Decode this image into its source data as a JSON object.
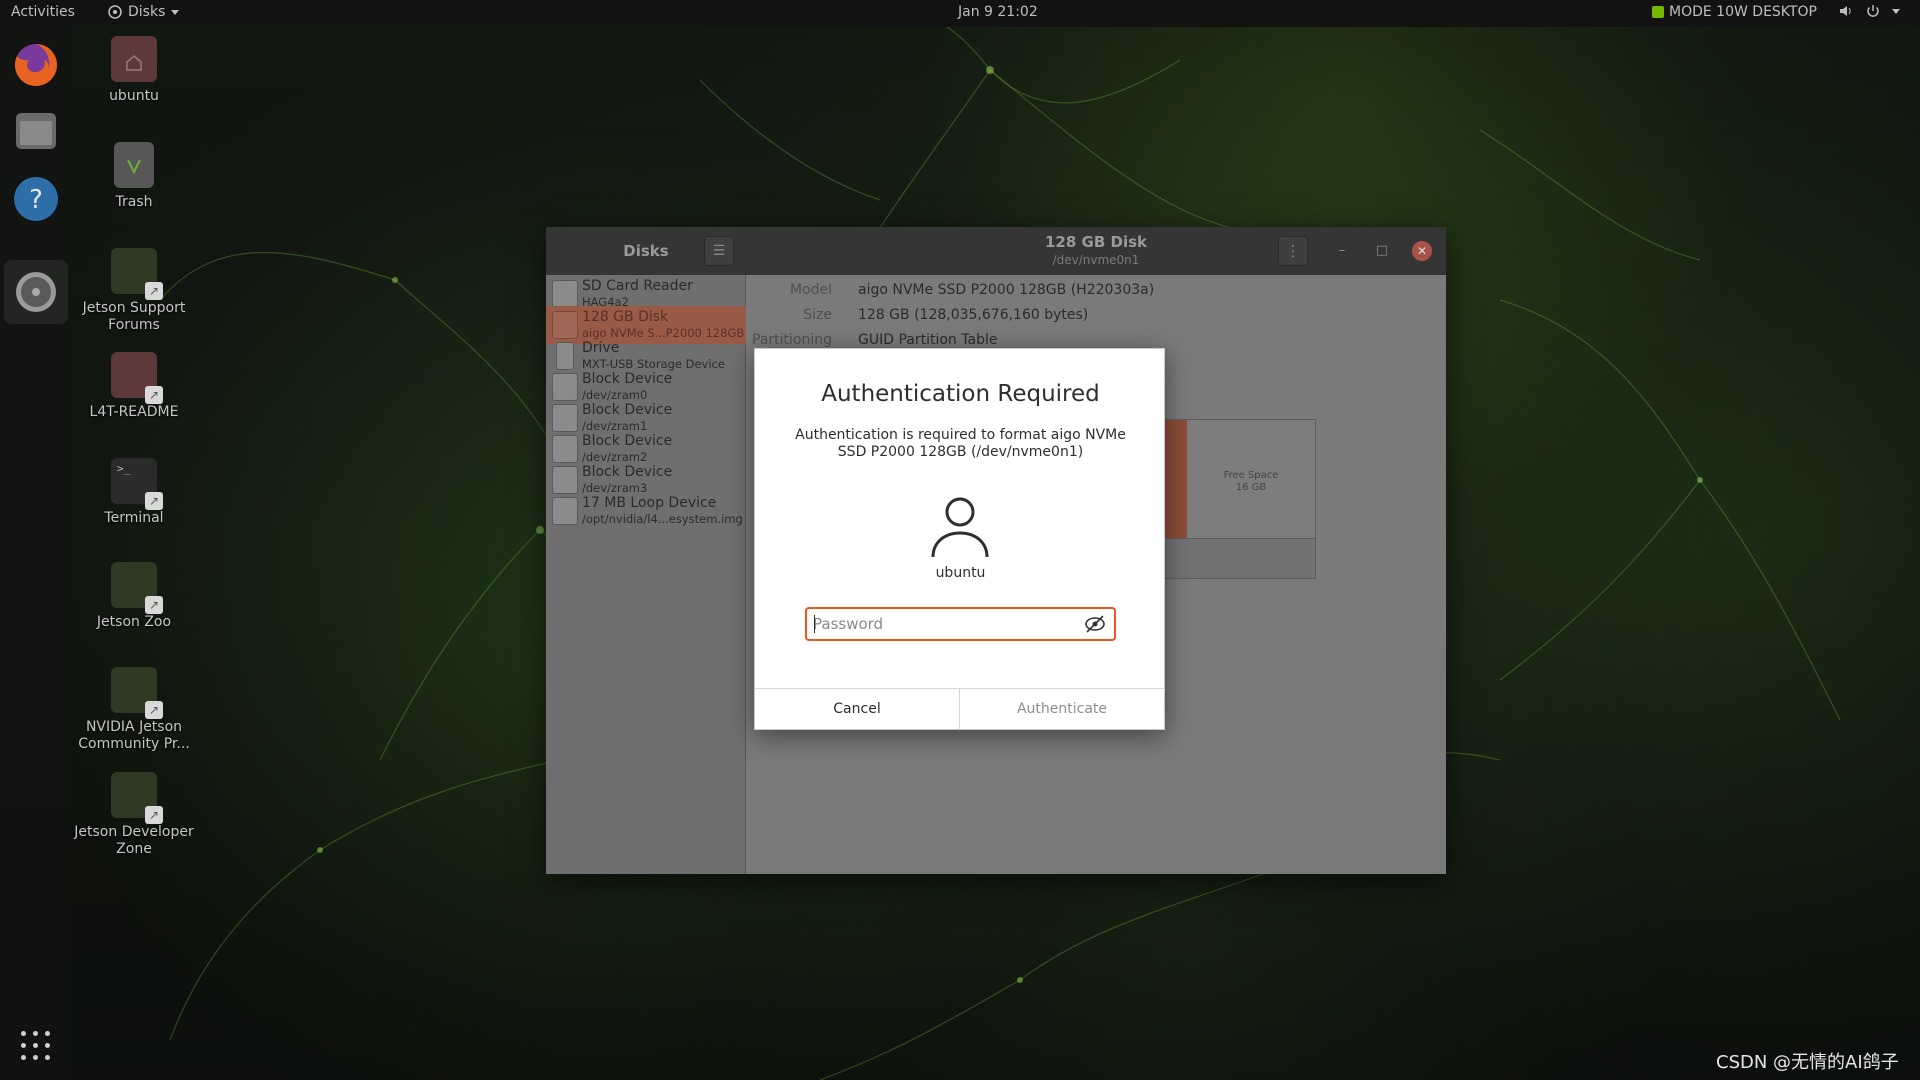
{
  "topbar": {
    "activities": "Activities",
    "app_name": "Disks",
    "clock": "Jan 9  21:02",
    "power_mode": "MODE 10W DESKTOP"
  },
  "dock": {
    "items": [
      {
        "name": "Firefox",
        "icon": "firefox-icon"
      },
      {
        "name": "Files",
        "icon": "files-icon"
      },
      {
        "name": "Help",
        "icon": "help-icon"
      },
      {
        "name": "Disks",
        "icon": "disks-icon"
      }
    ]
  },
  "desktop": {
    "icons": [
      {
        "label": "ubuntu",
        "icon": "home-folder-icon"
      },
      {
        "label": "Trash",
        "icon": "trash-icon"
      },
      {
        "label": "Jetson Support Forums",
        "icon": "nvidia-link-icon"
      },
      {
        "label": "L4T-README",
        "icon": "folder-link-icon"
      },
      {
        "label": "Terminal",
        "icon": "terminal-icon"
      },
      {
        "label": "Jetson Zoo",
        "icon": "nvidia-link-icon"
      },
      {
        "label": "NVIDIA Jetson Community Pr...",
        "icon": "nvidia-link-icon"
      },
      {
        "label": "Jetson Developer Zone",
        "icon": "nvidia-link-icon"
      }
    ]
  },
  "disks_window": {
    "sidebar_title": "Disks",
    "disk_title": "128 GB Disk",
    "disk_path": "/dev/nvme0n1",
    "devices": [
      {
        "name": "SD Card Reader",
        "sub": "HAG4a2"
      },
      {
        "name": "128 GB Disk",
        "sub": "aigo NVMe S...P2000 128GB"
      },
      {
        "name": "Drive",
        "sub": "MXT-USB Storage Device"
      },
      {
        "name": "Block Device",
        "sub": "/dev/zram0"
      },
      {
        "name": "Block Device",
        "sub": "/dev/zram1"
      },
      {
        "name": "Block Device",
        "sub": "/dev/zram2"
      },
      {
        "name": "Block Device",
        "sub": "/dev/zram3"
      },
      {
        "name": "17 MB Loop Device",
        "sub": "/opt/nvidia/l4...esystem.img"
      }
    ],
    "properties": {
      "model_label": "Model",
      "model_value": "aigo NVMe SSD P2000 128GB (H220303a)",
      "size_label": "Size",
      "size_value": "128 GB (128,035,676,160 bytes)",
      "partitioning_label": "Partitioning",
      "partitioning_value": "GUID Partition Table"
    },
    "volume_free_label": "Free Space",
    "volume_free_size": "16 GB"
  },
  "auth_dialog": {
    "title": "Authentication Required",
    "message": "Authentication is required to format aigo NVMe SSD P2000 128GB (/dev/nvme0n1)",
    "username": "ubuntu",
    "password_value": "",
    "password_placeholder": "Password",
    "cancel_label": "Cancel",
    "authenticate_label": "Authenticate"
  },
  "watermark": "CSDN @无情的AI鸽子",
  "colors": {
    "accent": "#e95420",
    "selected_row": "#9a5a48",
    "partition": "#8c4c39"
  }
}
